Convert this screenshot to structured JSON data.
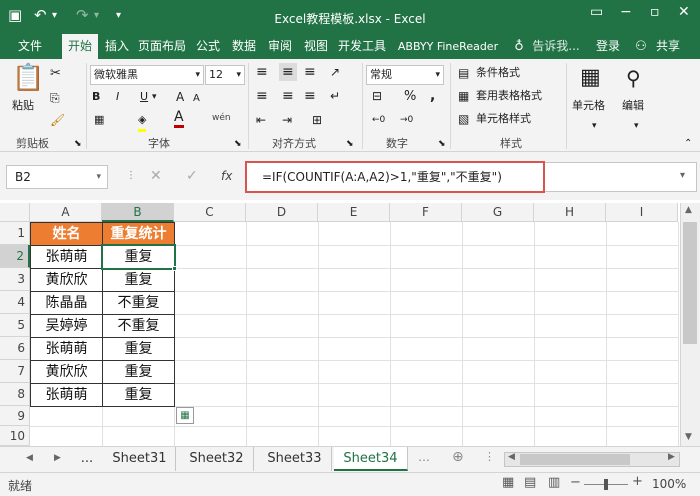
{
  "window": {
    "title": "Excel教程模板.xlsx - Excel"
  },
  "ribbon_tabs": [
    "文件",
    "开始",
    "插入",
    "页面布局",
    "公式",
    "数据",
    "审阅",
    "视图",
    "开发工具",
    "ABBYY FineReader"
  ],
  "tell_me": "告诉我...",
  "login": "登录",
  "share": "共享",
  "ribbon": {
    "paste_label": "粘贴",
    "clipboard_group": "剪贴板",
    "font_name": "微软雅黑",
    "font_size": "12",
    "font_group": "字体",
    "align_group": "对齐方式",
    "number_format": "常规",
    "number_group": "数字",
    "cond_format": "条件格式",
    "table_format": "套用表格格式",
    "cell_style": "单元格样式",
    "style_group": "样式",
    "cells_label": "单元格",
    "edit_label": "编辑",
    "bold": "B",
    "italic": "I",
    "underline": "U",
    "percent": "%",
    "comma": ","
  },
  "formula_bar": {
    "name_box": "B2",
    "fx": "fx",
    "formula": "=IF(COUNTIF(A:A,A2)>1,\"重复\",\"不重复\")"
  },
  "columns": [
    "A",
    "B",
    "C",
    "D",
    "E",
    "F",
    "G",
    "H",
    "I"
  ],
  "rows": [
    "1",
    "2",
    "3",
    "4",
    "5",
    "6",
    "7",
    "8",
    "9",
    "10"
  ],
  "table": {
    "headers": [
      "姓名",
      "重复统计"
    ],
    "rows": [
      [
        "张萌萌",
        "重复"
      ],
      [
        "黄欣欣",
        "重复"
      ],
      [
        "陈晶晶",
        "不重复"
      ],
      [
        "吴婷婷",
        "不重复"
      ],
      [
        "张萌萌",
        "重复"
      ],
      [
        "黄欣欣",
        "重复"
      ],
      [
        "张萌萌",
        "重复"
      ]
    ]
  },
  "sheets": [
    "...",
    "Sheet31",
    "Sheet32",
    "Sheet33",
    "Sheet34"
  ],
  "active_sheet": "Sheet34",
  "status": {
    "ready": "就绪",
    "zoom": "100%"
  },
  "colors": {
    "excel_green": "#217346",
    "header_orange": "#ed7d31",
    "highlight_red": "#d9534f"
  }
}
